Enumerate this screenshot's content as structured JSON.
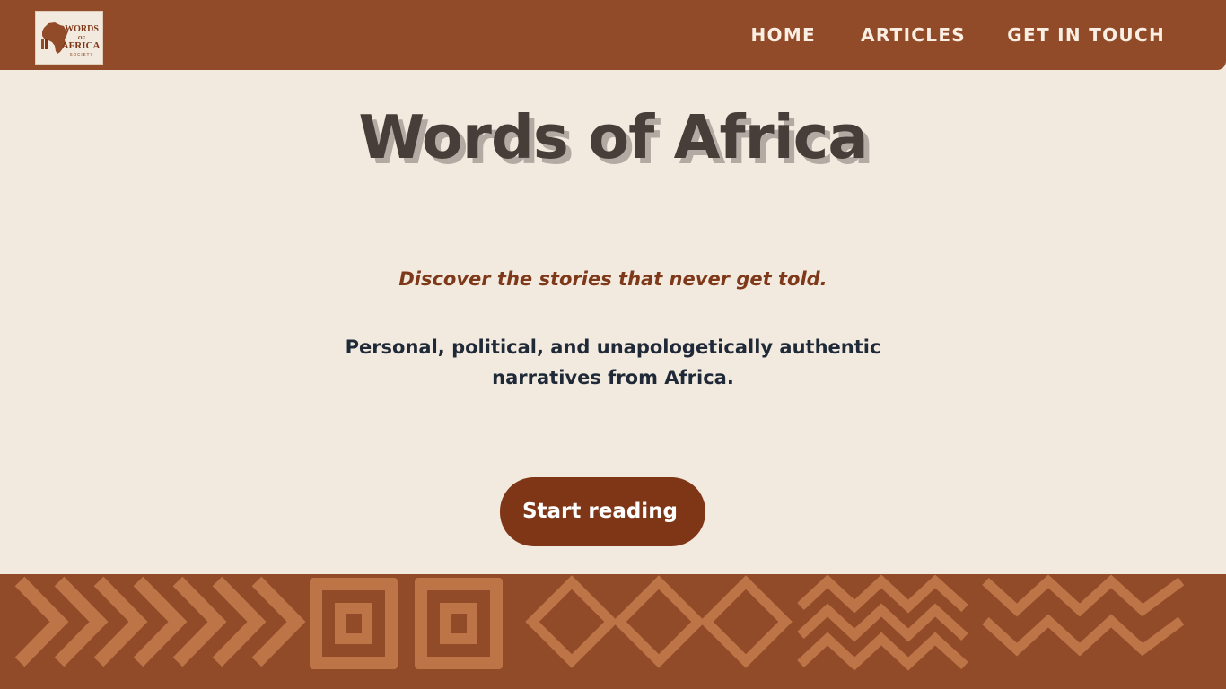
{
  "header": {
    "logo": {
      "line1": "WORDS",
      "line2": "OF",
      "line3": "AFRICA",
      "line4": "SOCIETY",
      "icon": "africa-map-icon"
    },
    "nav": [
      {
        "label": "HOME"
      },
      {
        "label": "ARTICLES"
      },
      {
        "label": "GET IN TOUCH"
      }
    ]
  },
  "hero": {
    "title": "Words of Africa",
    "tagline": "Discover the stories that never get told.",
    "description": "Personal, political, and unapologetically authentic narratives from Africa.",
    "cta_label": "Start reading"
  },
  "footer_pattern": {
    "motifs": [
      "chevrons",
      "nested-squares",
      "diamonds",
      "zigzags",
      "zigzags"
    ]
  },
  "colors": {
    "brand_brown": "#924b29",
    "cta_brown": "#7e3616",
    "background_cream": "#f3eadf",
    "title_dark": "#473d39",
    "tagline_rust": "#7e381a",
    "pattern_ochre": "#bd7447"
  }
}
